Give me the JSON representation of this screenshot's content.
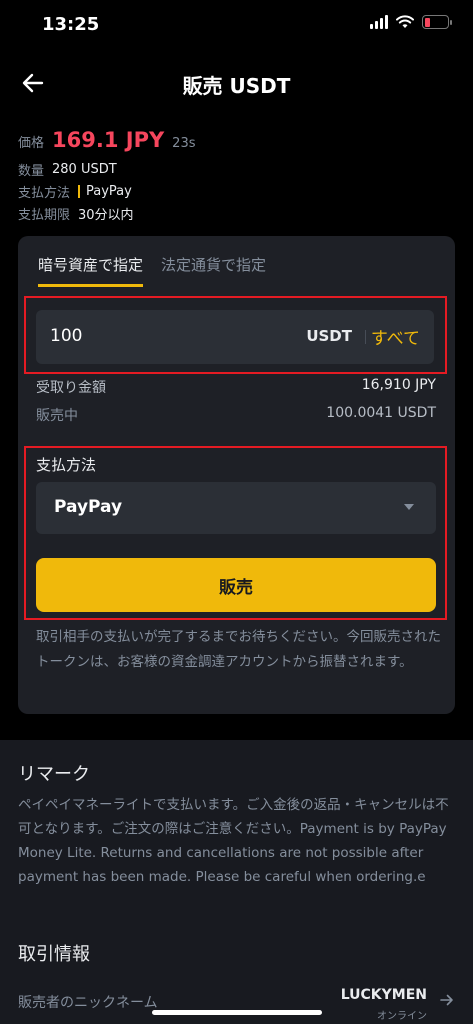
{
  "status_bar": {
    "time": "13:25"
  },
  "nav": {
    "title": "販売 USDT"
  },
  "info": {
    "price_label": "価格",
    "price_value": "169.1 JPY",
    "timer": "23s",
    "quantity_label": "数量",
    "quantity_value": "280 USDT",
    "payment_label": "支払方法",
    "payment_value": "PayPay",
    "deadline_label": "支払期限",
    "deadline_value": "30分以内"
  },
  "tabs": [
    {
      "label": "暗号資産で指定",
      "active": true
    },
    {
      "label": "法定通貨で指定",
      "active": false
    }
  ],
  "amount": {
    "value": "100",
    "unit": "USDT",
    "all_label": "すべて"
  },
  "summary": [
    {
      "label": "受取り金額",
      "value": "16,910 JPY"
    },
    {
      "label": "販売中",
      "value": "100.0041 USDT"
    }
  ],
  "payment_method": {
    "label": "支払方法",
    "selected": "PayPay"
  },
  "sell_button": "販売",
  "note": "取引相手の支払いが完了するまでお待ちください。今回販売されたトークンは、お客様の資金調達アカウントから振替されます。",
  "remark": {
    "title": "リマーク",
    "body": "ペイペイマネーライトで支払います。ご入金後の返品・キャンセルは不可となります。ご注文の際はご注意ください。Payment is by PayPay Money Lite. Returns and cancellations are not possible after payment has been made. Please be careful when ordering.e"
  },
  "trade_info": {
    "title": "取引情報",
    "nickname_label": "販売者のニックネーム",
    "nickname_value": "LUCKYMEN",
    "online_status": "オンライン"
  },
  "colors": {
    "accent": "#f0b90b",
    "price_red": "#f6465d",
    "highlight_border": "#e51b23",
    "card_bg": "#1e2026"
  },
  "icons": [
    "back-arrow-icon",
    "signal-icon",
    "wifi-icon",
    "battery-icon",
    "chevron-down-icon",
    "right-arrow-icon"
  ]
}
